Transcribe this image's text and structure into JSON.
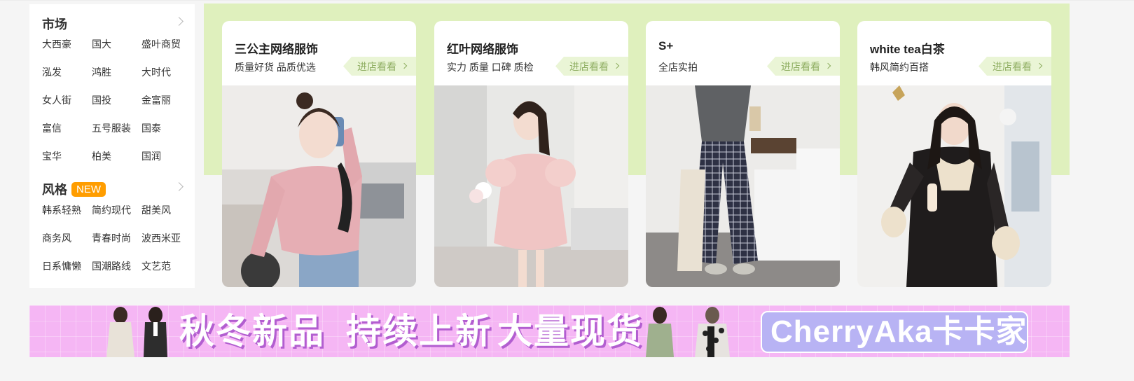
{
  "market": {
    "title": "市场",
    "items": [
      "大西豪",
      "国大",
      "盛叶商贸",
      "泓发",
      "鸿胜",
      "大时代",
      "女人街",
      "国投",
      "金富丽",
      "富信",
      "五号服装",
      "国泰",
      "宝华",
      "柏美",
      "国润"
    ]
  },
  "style": {
    "title": "风格",
    "badge": "NEW",
    "items": [
      "韩系轻熟",
      "简约现代",
      "甜美风",
      "商务风",
      "青春时尚",
      "波西米亚",
      "日系慵懒",
      "国潮路线",
      "文艺范"
    ]
  },
  "shops": [
    {
      "name": "三公主网络服饰",
      "tagline": "质量好货 品质优选",
      "enter_label": "进店看看"
    },
    {
      "name": "红叶网络服饰",
      "tagline": "实力 质量 口碑 质检",
      "enter_label": "进店看看"
    },
    {
      "name": "S+",
      "tagline": "全店实拍",
      "enter_label": "进店看看"
    },
    {
      "name": "white tea白茶",
      "tagline": "韩风简约百搭",
      "enter_label": "进店看看"
    }
  ],
  "banner": {
    "slogan_1": "秋冬新品",
    "slogan_2": "持续上新",
    "slogan_3": "大量现货",
    "brand": "CherryAka卡卡家"
  },
  "colors": {
    "accent_green_bg": "#dff0bd",
    "enter_button_text": "#8fae62",
    "new_badge": "#ff9d00",
    "banner_bg": "#f5b6f4",
    "brand_box": "#b8b3f4"
  }
}
